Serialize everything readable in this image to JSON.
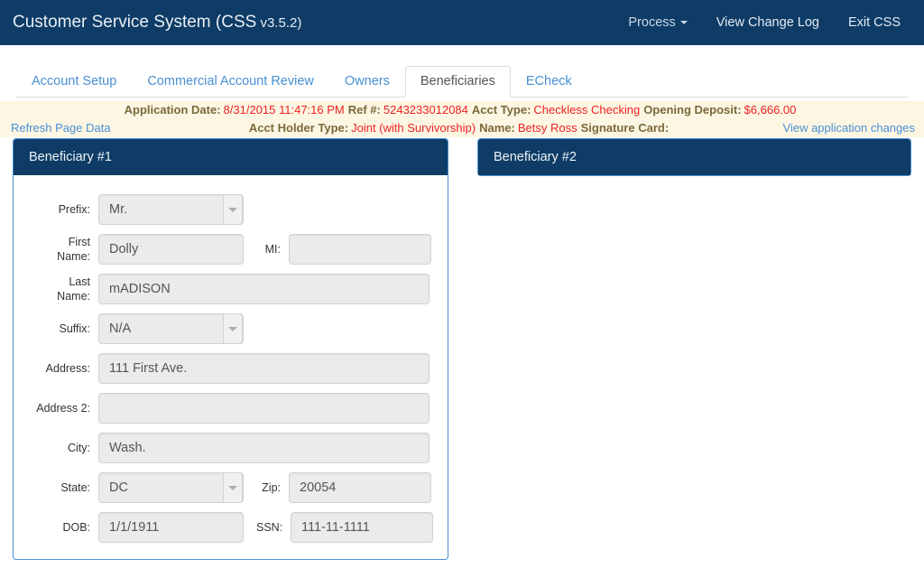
{
  "navbar": {
    "brand_main": "Customer Service System (CSS",
    "brand_version": " v3.5.2)",
    "links": [
      {
        "label": "Process",
        "has_caret": true,
        "icon": "chevron-down-icon"
      },
      {
        "label": "View Change Log",
        "has_caret": false
      },
      {
        "label": "Exit CSS",
        "has_caret": false
      }
    ]
  },
  "tabs": [
    {
      "label": "Account Setup",
      "active": false
    },
    {
      "label": "Commercial Account Review",
      "active": false
    },
    {
      "label": "Owners",
      "active": false
    },
    {
      "label": "Beneficiaries",
      "active": true
    },
    {
      "label": "ECheck",
      "active": false
    }
  ],
  "banner": {
    "line1": {
      "application_date_label": "Application Date",
      "application_date_value": "8/31/2015 11:47:16 PM",
      "ref_label": "Ref #",
      "ref_value": "5243233012084",
      "acct_type_label": "Acct Type",
      "acct_type_value": "Checkless Checking",
      "opening_deposit_label": "Opening Deposit",
      "opening_deposit_value": "$6,666.00"
    },
    "line2": {
      "refresh_link": "Refresh Page Data",
      "acct_holder_type_label": "Acct Holder Type",
      "acct_holder_type_value": "Joint (with Survivorship)",
      "name_label": "Name",
      "name_value": "Betsy Ross",
      "signature_card_label": "Signature Card",
      "signature_card_value": "",
      "view_changes_link": "View application changes"
    }
  },
  "panels": [
    {
      "title": "Beneficiary #1",
      "fields": {
        "prefix_label": "Prefix:",
        "prefix_value": "Mr.",
        "first_name_label_1": "First",
        "first_name_label_2": "Name:",
        "first_name_value": "Dolly",
        "mi_label": "MI:",
        "mi_value": "",
        "last_name_label_1": "Last",
        "last_name_label_2": "Name:",
        "last_name_value": "mADISON",
        "suffix_label": "Suffix:",
        "suffix_value": "N/A",
        "address_label": "Address:",
        "address_value": "111 First Ave.",
        "address2_label": "Address 2:",
        "address2_value": "",
        "city_label": "City:",
        "city_value": "Wash.",
        "state_label": "State:",
        "state_value": "DC",
        "zip_label": "Zip:",
        "zip_value": "20054",
        "dob_label": "DOB:",
        "dob_value": "1/1/1911",
        "ssn_label": "SSN:",
        "ssn_value": "111-11-1111"
      }
    },
    {
      "title": "Beneficiary #2"
    }
  ],
  "colors": {
    "navy": "#0e3c66",
    "link_blue": "#4a8fd4",
    "banner_bg": "#fdf6e3",
    "banner_label": "#7a6a3a",
    "banner_value": "#ee2222",
    "field_bg": "#ebebeb"
  }
}
